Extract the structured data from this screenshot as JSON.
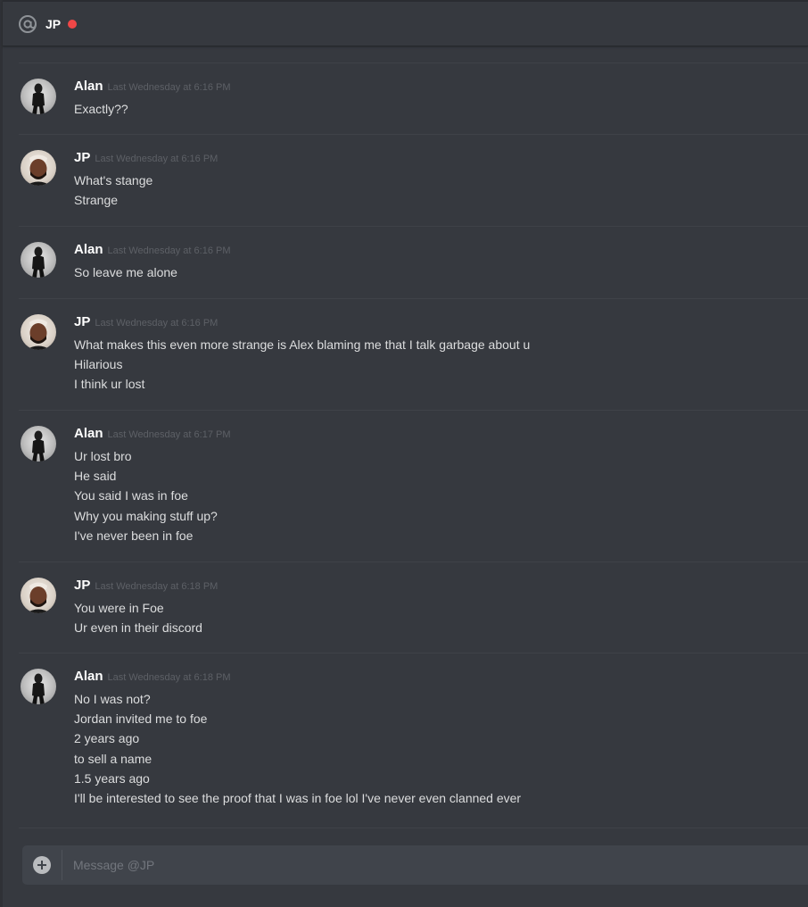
{
  "header": {
    "recipient": "JP",
    "status_color": "#f04747",
    "icon": "at-icon"
  },
  "messages": [
    {
      "author": "Alan",
      "avatar": "alan-avatar",
      "timestamp": "Last Wednesday at 6:16 PM",
      "lines": [
        "Exactly??"
      ]
    },
    {
      "author": "JP",
      "avatar": "jp-avatar",
      "timestamp": "Last Wednesday at 6:16 PM",
      "lines": [
        "What's stange",
        "Strange"
      ]
    },
    {
      "author": "Alan",
      "avatar": "alan-avatar",
      "timestamp": "Last Wednesday at 6:16 PM",
      "lines": [
        "So leave me alone"
      ]
    },
    {
      "author": "JP",
      "avatar": "jp-avatar",
      "timestamp": "Last Wednesday at 6:16 PM",
      "lines": [
        "What makes this even more strange is Alex blaming me that I talk garbage about u",
        "Hilarious",
        "I think ur lost"
      ]
    },
    {
      "author": "Alan",
      "avatar": "alan-avatar",
      "timestamp": "Last Wednesday at 6:17 PM",
      "lines": [
        "Ur lost bro",
        "He said",
        "You said I was in foe",
        "Why you making stuff up?",
        "I've never been in foe"
      ]
    },
    {
      "author": "JP",
      "avatar": "jp-avatar",
      "timestamp": "Last Wednesday at 6:18 PM",
      "lines": [
        "You were in Foe",
        "Ur even in their discord"
      ]
    },
    {
      "author": "Alan",
      "avatar": "alan-avatar",
      "timestamp": "Last Wednesday at 6:18 PM",
      "lines": [
        "No I was not?",
        "Jordan invited me to foe",
        "2 years ago",
        "to sell a name",
        "1.5 years ago",
        "I'll be interested to see the proof that I was in foe lol I've never even clanned ever"
      ]
    }
  ],
  "composer": {
    "placeholder": "Message @JP",
    "value": ""
  }
}
